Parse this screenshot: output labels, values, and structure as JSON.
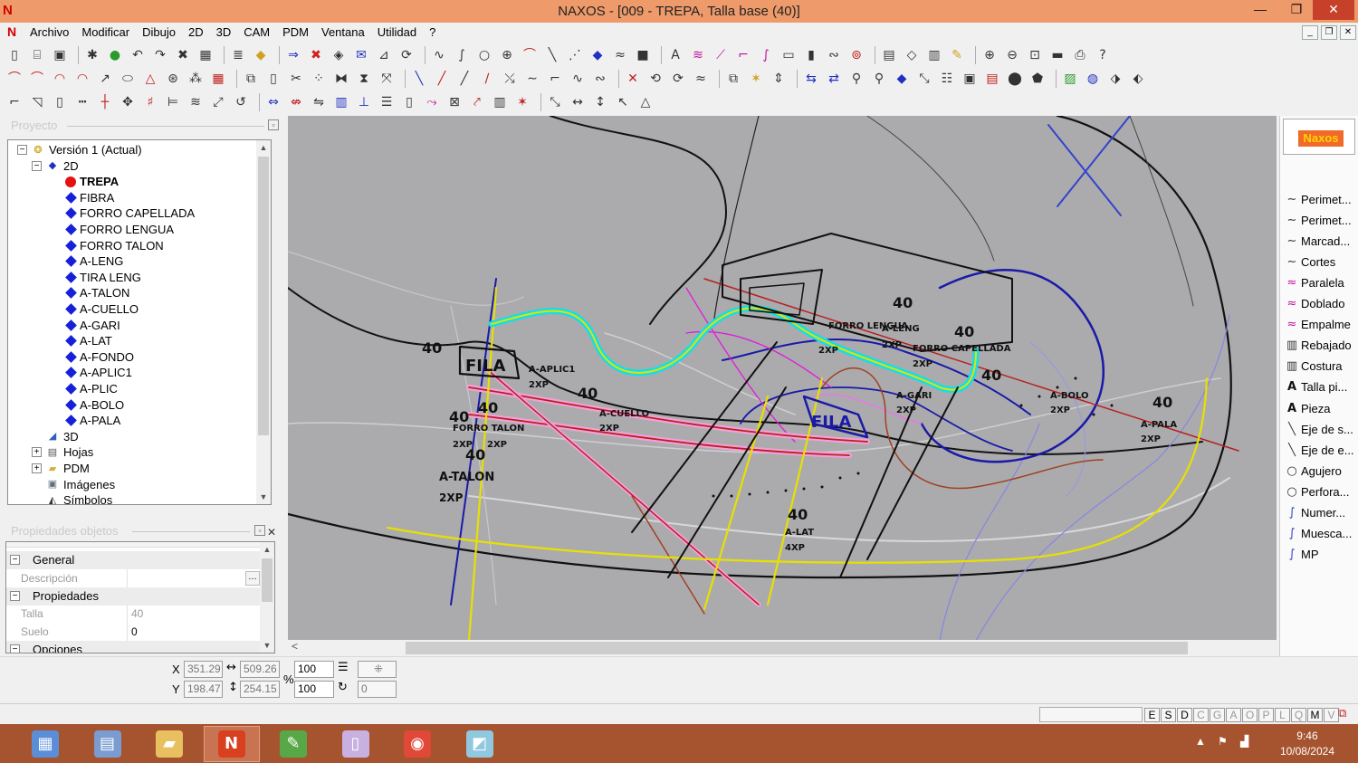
{
  "window": {
    "title": "NAXOS - [009 - TREPA, Talla base (40)]",
    "app_letter": "N",
    "minimize": "—",
    "maximize": "❐",
    "close": "✕"
  },
  "menu": {
    "items": [
      "Archivo",
      "Modificar",
      "Dibujo",
      "2D",
      "3D",
      "CAM",
      "PDM",
      "Ventana",
      "Utilidad",
      "?"
    ]
  },
  "project_panel": {
    "title": "Proyecto",
    "tree": [
      {
        "label": "Versión 1 (Actual)",
        "level": 0,
        "expander": "−",
        "icon": "version-icon"
      },
      {
        "label": "2D",
        "level": 1,
        "expander": "−",
        "icon": "2d-icon"
      },
      {
        "label": "TREPA",
        "level": 2,
        "icon": "red-dot-icon",
        "selected": true
      },
      {
        "label": "FIBRA",
        "level": 2,
        "icon": "diamond-icon"
      },
      {
        "label": "FORRO CAPELLADA",
        "level": 2,
        "icon": "diamond-icon"
      },
      {
        "label": "FORRO LENGUA",
        "level": 2,
        "icon": "diamond-icon"
      },
      {
        "label": "FORRO TALON",
        "level": 2,
        "icon": "diamond-icon"
      },
      {
        "label": "A-LENG",
        "level": 2,
        "icon": "diamond-icon"
      },
      {
        "label": "TIRA LENG",
        "level": 2,
        "icon": "diamond-icon"
      },
      {
        "label": "A-TALON",
        "level": 2,
        "icon": "diamond-icon"
      },
      {
        "label": "A-CUELLO",
        "level": 2,
        "icon": "diamond-icon"
      },
      {
        "label": "A-GARI",
        "level": 2,
        "icon": "diamond-icon"
      },
      {
        "label": "A-LAT",
        "level": 2,
        "icon": "diamond-icon"
      },
      {
        "label": "A-FONDO",
        "level": 2,
        "icon": "diamond-icon"
      },
      {
        "label": "A-APLIC1",
        "level": 2,
        "icon": "diamond-icon"
      },
      {
        "label": "A-PLIC",
        "level": 2,
        "icon": "diamond-icon"
      },
      {
        "label": "A-BOLO",
        "level": 2,
        "icon": "diamond-icon"
      },
      {
        "label": "A-PALA",
        "level": 2,
        "icon": "diamond-icon"
      },
      {
        "label": "3D",
        "level": 1,
        "expander": "",
        "icon": "3d-icon"
      },
      {
        "label": "Hojas",
        "level": 1,
        "expander": "+",
        "icon": "sheets-icon"
      },
      {
        "label": "PDM",
        "level": 1,
        "expander": "+",
        "icon": "folder-icon"
      },
      {
        "label": "Imágenes",
        "level": 1,
        "expander": "",
        "icon": "images-icon"
      },
      {
        "label": "Símbolos",
        "level": 1,
        "expander": "",
        "icon": "symbols-icon"
      }
    ]
  },
  "properties_panel": {
    "title": "Propiedades objetos",
    "rows": [
      {
        "type": "group",
        "label": "General",
        "exp": "−"
      },
      {
        "type": "prop",
        "name": "Descripción",
        "value": "",
        "has_button": true
      },
      {
        "type": "group",
        "label": "Propiedades",
        "exp": "−"
      },
      {
        "type": "prop",
        "name": "Talla",
        "value": "40"
      },
      {
        "type": "prop",
        "name": "Suelo",
        "value": "0"
      },
      {
        "type": "group",
        "label": "Opciones",
        "exp": "−"
      }
    ]
  },
  "palette": {
    "logo": "Naxos",
    "items": [
      {
        "label": "Perimet...",
        "icon": "curve-icon",
        "color": "#333333"
      },
      {
        "label": "Perimet...",
        "icon": "curve-icon",
        "color": "#333333"
      },
      {
        "label": "Marcad...",
        "icon": "curve-icon",
        "color": "#333333"
      },
      {
        "label": "Cortes",
        "icon": "curve-icon",
        "color": "#333333"
      },
      {
        "label": "Paralela",
        "icon": "parallel-icon",
        "color": "#c0109a"
      },
      {
        "label": "Doblado",
        "icon": "fold-icon",
        "color": "#c0109a"
      },
      {
        "label": "Empalme",
        "icon": "splice-icon",
        "color": "#c0109a"
      },
      {
        "label": "Rebajado",
        "icon": "skive-icon",
        "color": "#333333"
      },
      {
        "label": "Costura",
        "icon": "seam-icon",
        "color": "#333333"
      },
      {
        "label": "Talla pi...",
        "icon": "text-a-icon",
        "color": "#111111"
      },
      {
        "label": "Pieza",
        "icon": "text-a-icon",
        "color": "#111111"
      },
      {
        "label": "Eje de s...",
        "icon": "axis-icon",
        "color": "#333333"
      },
      {
        "label": "Eje de e...",
        "icon": "axis-icon",
        "color": "#333333"
      },
      {
        "label": "Agujero",
        "icon": "hole-icon",
        "color": "#333333"
      },
      {
        "label": "Perfora...",
        "icon": "perforation-icon",
        "color": "#333333"
      },
      {
        "label": "Numer...",
        "icon": "number-icon",
        "color": "#3040c0"
      },
      {
        "label": "Muesca...",
        "icon": "notch-icon",
        "color": "#3040c0"
      },
      {
        "label": "MP",
        "icon": "mp-icon",
        "color": "#3040c0"
      }
    ]
  },
  "coords": {
    "x_label": "X",
    "y_label": "Y",
    "x": "351.29",
    "y": "198.47",
    "width": "509.26",
    "height": "254.15",
    "percent_sign": "%",
    "scale_x": "100",
    "scale_y": "100",
    "rotation": "0"
  },
  "layer_letters": [
    "E",
    "S",
    "D",
    "C",
    "G",
    "A",
    "O",
    "P",
    "L",
    "Q",
    "M",
    "V"
  ],
  "drawing_labels": [
    "40",
    "40",
    "40",
    "40",
    "40",
    "40",
    "40",
    "40",
    "40",
    "40",
    "A-APLIC1",
    "2XP",
    "A-CUELLO",
    "2XP",
    "FORRO TALON",
    "2XP",
    "2XP",
    "A-TALON",
    "2XP",
    "FORRO LENGUA",
    "A-LENG",
    "2XP",
    "FORRO CAPELLADA",
    "2XP",
    "A-GARI",
    "2XP",
    "A-BOLO",
    "2XP",
    "A-PALA",
    "2XP",
    "A-LAT",
    "4XP",
    "FILA",
    "FILA",
    "2XP"
  ],
  "taskbar": {
    "time": "9:46",
    "date": "10/08/2024",
    "apps": [
      {
        "name": "calculator-icon",
        "color": "#5a8fd8"
      },
      {
        "name": "explorer-icon",
        "color": "#7a9cd0"
      },
      {
        "name": "files-icon",
        "color": "#e8c060"
      },
      {
        "name": "naxos-icon",
        "color": "#d84020"
      },
      {
        "name": "draw-icon",
        "color": "#58a848"
      },
      {
        "name": "notes-icon",
        "color": "#c8b0e0"
      },
      {
        "name": "chrome-icon",
        "color": "#e04838"
      },
      {
        "name": "app-icon",
        "color": "#90c8e0"
      }
    ]
  }
}
